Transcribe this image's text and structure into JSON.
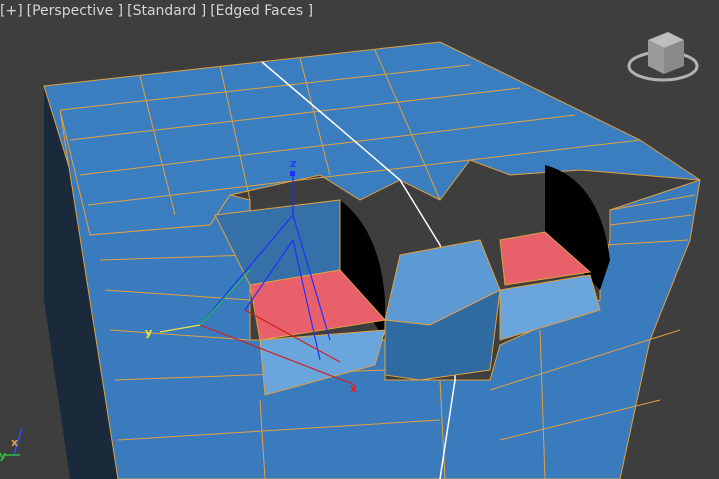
{
  "viewport": {
    "menu_plus": "[+]",
    "view_label": "[Perspective ]",
    "shading_label": "[Standard ]",
    "display_label": "[Edged Faces ]"
  },
  "gizmo": {
    "x": "x",
    "y": "y",
    "z": "z"
  },
  "axis_tripod": {
    "x": "x",
    "y": "y"
  },
  "colors": {
    "face": "#3b7ec0",
    "edge": "#e0a040",
    "selected": "#e8606a",
    "background": "#3e3e3e"
  },
  "icons": {
    "viewcube": "viewcube-icon"
  }
}
